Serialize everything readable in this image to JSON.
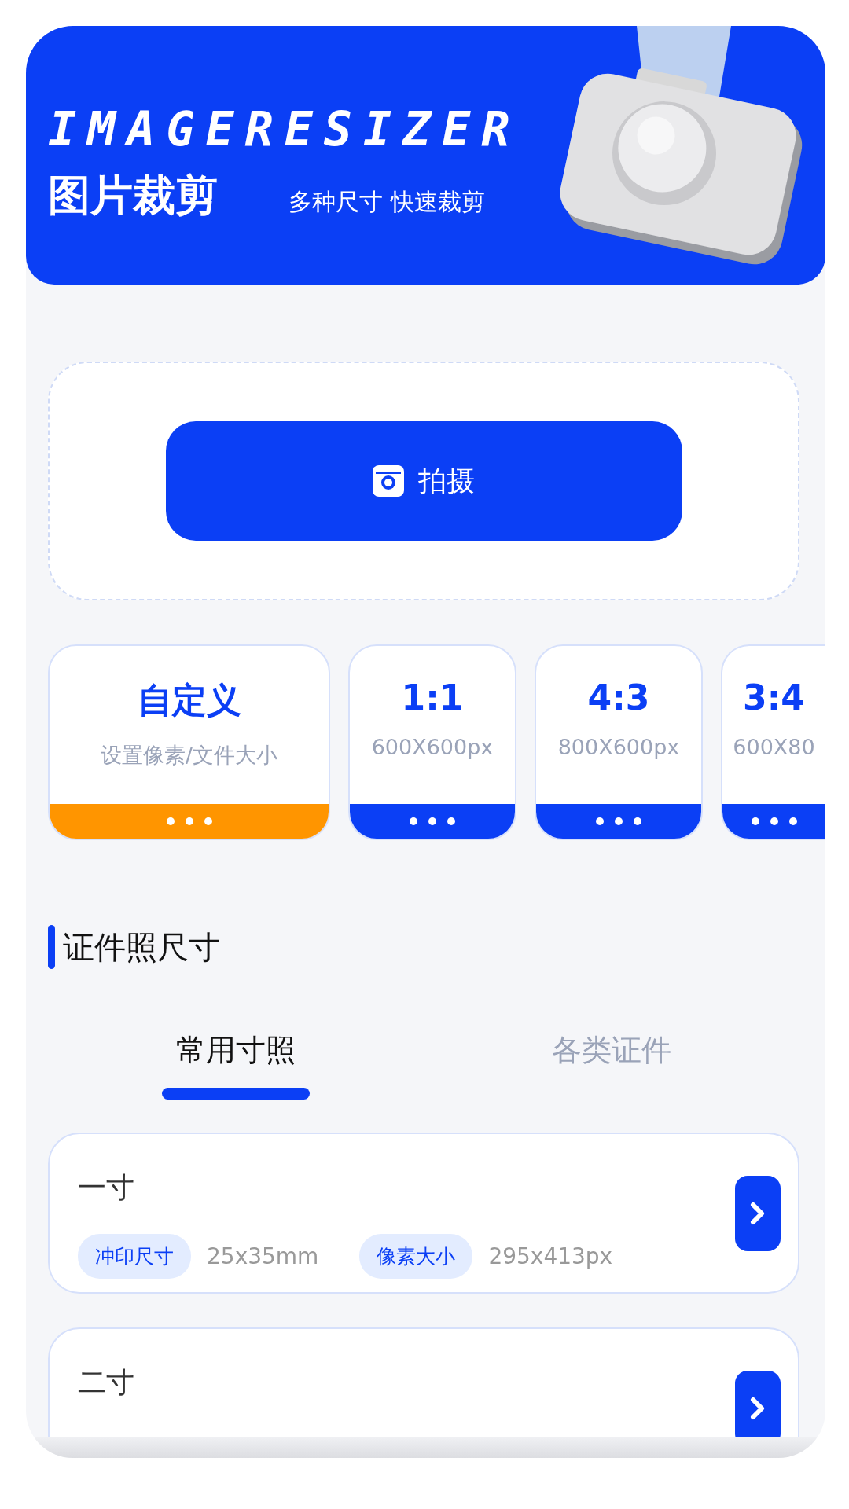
{
  "header": {
    "logo_text": "IMAGERESIZER",
    "title": "图片裁剪",
    "slogan": "多种尺寸 快速裁剪"
  },
  "capture_button": {
    "label": "拍摄"
  },
  "presets": [
    {
      "title": "自定义",
      "subtitle": "设置像素/文件大小",
      "selected": true
    },
    {
      "title": "1:1",
      "subtitle": "600X600px",
      "selected": false
    },
    {
      "title": "4:3",
      "subtitle": "800X600px",
      "selected": false
    },
    {
      "title": "3:4",
      "subtitle": "600X80",
      "selected": false
    }
  ],
  "section_title": "证件照尺寸",
  "tabs": [
    {
      "label": "常用寸照",
      "selected": true
    },
    {
      "label": "各类证件",
      "selected": false
    }
  ],
  "sizes": [
    {
      "name": "一寸",
      "tags": [
        {
          "label": "冲印尺寸",
          "value": "25x35mm"
        },
        {
          "label": "像素大小",
          "value": "295x413px"
        }
      ]
    },
    {
      "name": "二寸"
    }
  ]
}
